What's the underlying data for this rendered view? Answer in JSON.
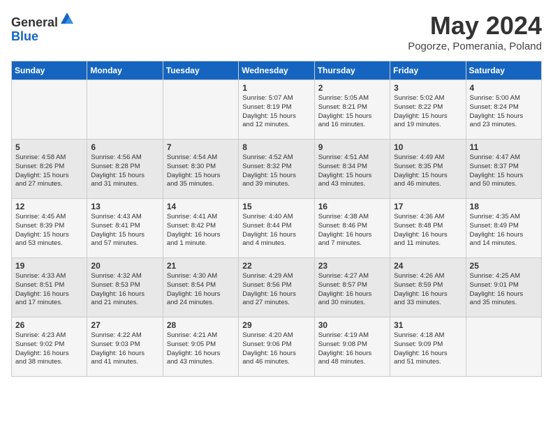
{
  "header": {
    "logo_general": "General",
    "logo_blue": "Blue",
    "month_title": "May 2024",
    "location": "Pogorze, Pomerania, Poland"
  },
  "weekdays": [
    "Sunday",
    "Monday",
    "Tuesday",
    "Wednesday",
    "Thursday",
    "Friday",
    "Saturday"
  ],
  "weeks": [
    [
      {
        "day": "",
        "info": ""
      },
      {
        "day": "",
        "info": ""
      },
      {
        "day": "",
        "info": ""
      },
      {
        "day": "1",
        "info": "Sunrise: 5:07 AM\nSunset: 8:19 PM\nDaylight: 15 hours\nand 12 minutes."
      },
      {
        "day": "2",
        "info": "Sunrise: 5:05 AM\nSunset: 8:21 PM\nDaylight: 15 hours\nand 16 minutes."
      },
      {
        "day": "3",
        "info": "Sunrise: 5:02 AM\nSunset: 8:22 PM\nDaylight: 15 hours\nand 19 minutes."
      },
      {
        "day": "4",
        "info": "Sunrise: 5:00 AM\nSunset: 8:24 PM\nDaylight: 15 hours\nand 23 minutes."
      }
    ],
    [
      {
        "day": "5",
        "info": "Sunrise: 4:58 AM\nSunset: 8:26 PM\nDaylight: 15 hours\nand 27 minutes."
      },
      {
        "day": "6",
        "info": "Sunrise: 4:56 AM\nSunset: 8:28 PM\nDaylight: 15 hours\nand 31 minutes."
      },
      {
        "day": "7",
        "info": "Sunrise: 4:54 AM\nSunset: 8:30 PM\nDaylight: 15 hours\nand 35 minutes."
      },
      {
        "day": "8",
        "info": "Sunrise: 4:52 AM\nSunset: 8:32 PM\nDaylight: 15 hours\nand 39 minutes."
      },
      {
        "day": "9",
        "info": "Sunrise: 4:51 AM\nSunset: 8:34 PM\nDaylight: 15 hours\nand 43 minutes."
      },
      {
        "day": "10",
        "info": "Sunrise: 4:49 AM\nSunset: 8:35 PM\nDaylight: 15 hours\nand 46 minutes."
      },
      {
        "day": "11",
        "info": "Sunrise: 4:47 AM\nSunset: 8:37 PM\nDaylight: 15 hours\nand 50 minutes."
      }
    ],
    [
      {
        "day": "12",
        "info": "Sunrise: 4:45 AM\nSunset: 8:39 PM\nDaylight: 15 hours\nand 53 minutes."
      },
      {
        "day": "13",
        "info": "Sunrise: 4:43 AM\nSunset: 8:41 PM\nDaylight: 15 hours\nand 57 minutes."
      },
      {
        "day": "14",
        "info": "Sunrise: 4:41 AM\nSunset: 8:42 PM\nDaylight: 16 hours\nand 1 minute."
      },
      {
        "day": "15",
        "info": "Sunrise: 4:40 AM\nSunset: 8:44 PM\nDaylight: 16 hours\nand 4 minutes."
      },
      {
        "day": "16",
        "info": "Sunrise: 4:38 AM\nSunset: 8:46 PM\nDaylight: 16 hours\nand 7 minutes."
      },
      {
        "day": "17",
        "info": "Sunrise: 4:36 AM\nSunset: 8:48 PM\nDaylight: 16 hours\nand 11 minutes."
      },
      {
        "day": "18",
        "info": "Sunrise: 4:35 AM\nSunset: 8:49 PM\nDaylight: 16 hours\nand 14 minutes."
      }
    ],
    [
      {
        "day": "19",
        "info": "Sunrise: 4:33 AM\nSunset: 8:51 PM\nDaylight: 16 hours\nand 17 minutes."
      },
      {
        "day": "20",
        "info": "Sunrise: 4:32 AM\nSunset: 8:53 PM\nDaylight: 16 hours\nand 21 minutes."
      },
      {
        "day": "21",
        "info": "Sunrise: 4:30 AM\nSunset: 8:54 PM\nDaylight: 16 hours\nand 24 minutes."
      },
      {
        "day": "22",
        "info": "Sunrise: 4:29 AM\nSunset: 8:56 PM\nDaylight: 16 hours\nand 27 minutes."
      },
      {
        "day": "23",
        "info": "Sunrise: 4:27 AM\nSunset: 8:57 PM\nDaylight: 16 hours\nand 30 minutes."
      },
      {
        "day": "24",
        "info": "Sunrise: 4:26 AM\nSunset: 8:59 PM\nDaylight: 16 hours\nand 33 minutes."
      },
      {
        "day": "25",
        "info": "Sunrise: 4:25 AM\nSunset: 9:01 PM\nDaylight: 16 hours\nand 35 minutes."
      }
    ],
    [
      {
        "day": "26",
        "info": "Sunrise: 4:23 AM\nSunset: 9:02 PM\nDaylight: 16 hours\nand 38 minutes."
      },
      {
        "day": "27",
        "info": "Sunrise: 4:22 AM\nSunset: 9:03 PM\nDaylight: 16 hours\nand 41 minutes."
      },
      {
        "day": "28",
        "info": "Sunrise: 4:21 AM\nSunset: 9:05 PM\nDaylight: 16 hours\nand 43 minutes."
      },
      {
        "day": "29",
        "info": "Sunrise: 4:20 AM\nSunset: 9:06 PM\nDaylight: 16 hours\nand 46 minutes."
      },
      {
        "day": "30",
        "info": "Sunrise: 4:19 AM\nSunset: 9:08 PM\nDaylight: 16 hours\nand 48 minutes."
      },
      {
        "day": "31",
        "info": "Sunrise: 4:18 AM\nSunset: 9:09 PM\nDaylight: 16 hours\nand 51 minutes."
      },
      {
        "day": "",
        "info": ""
      }
    ]
  ]
}
